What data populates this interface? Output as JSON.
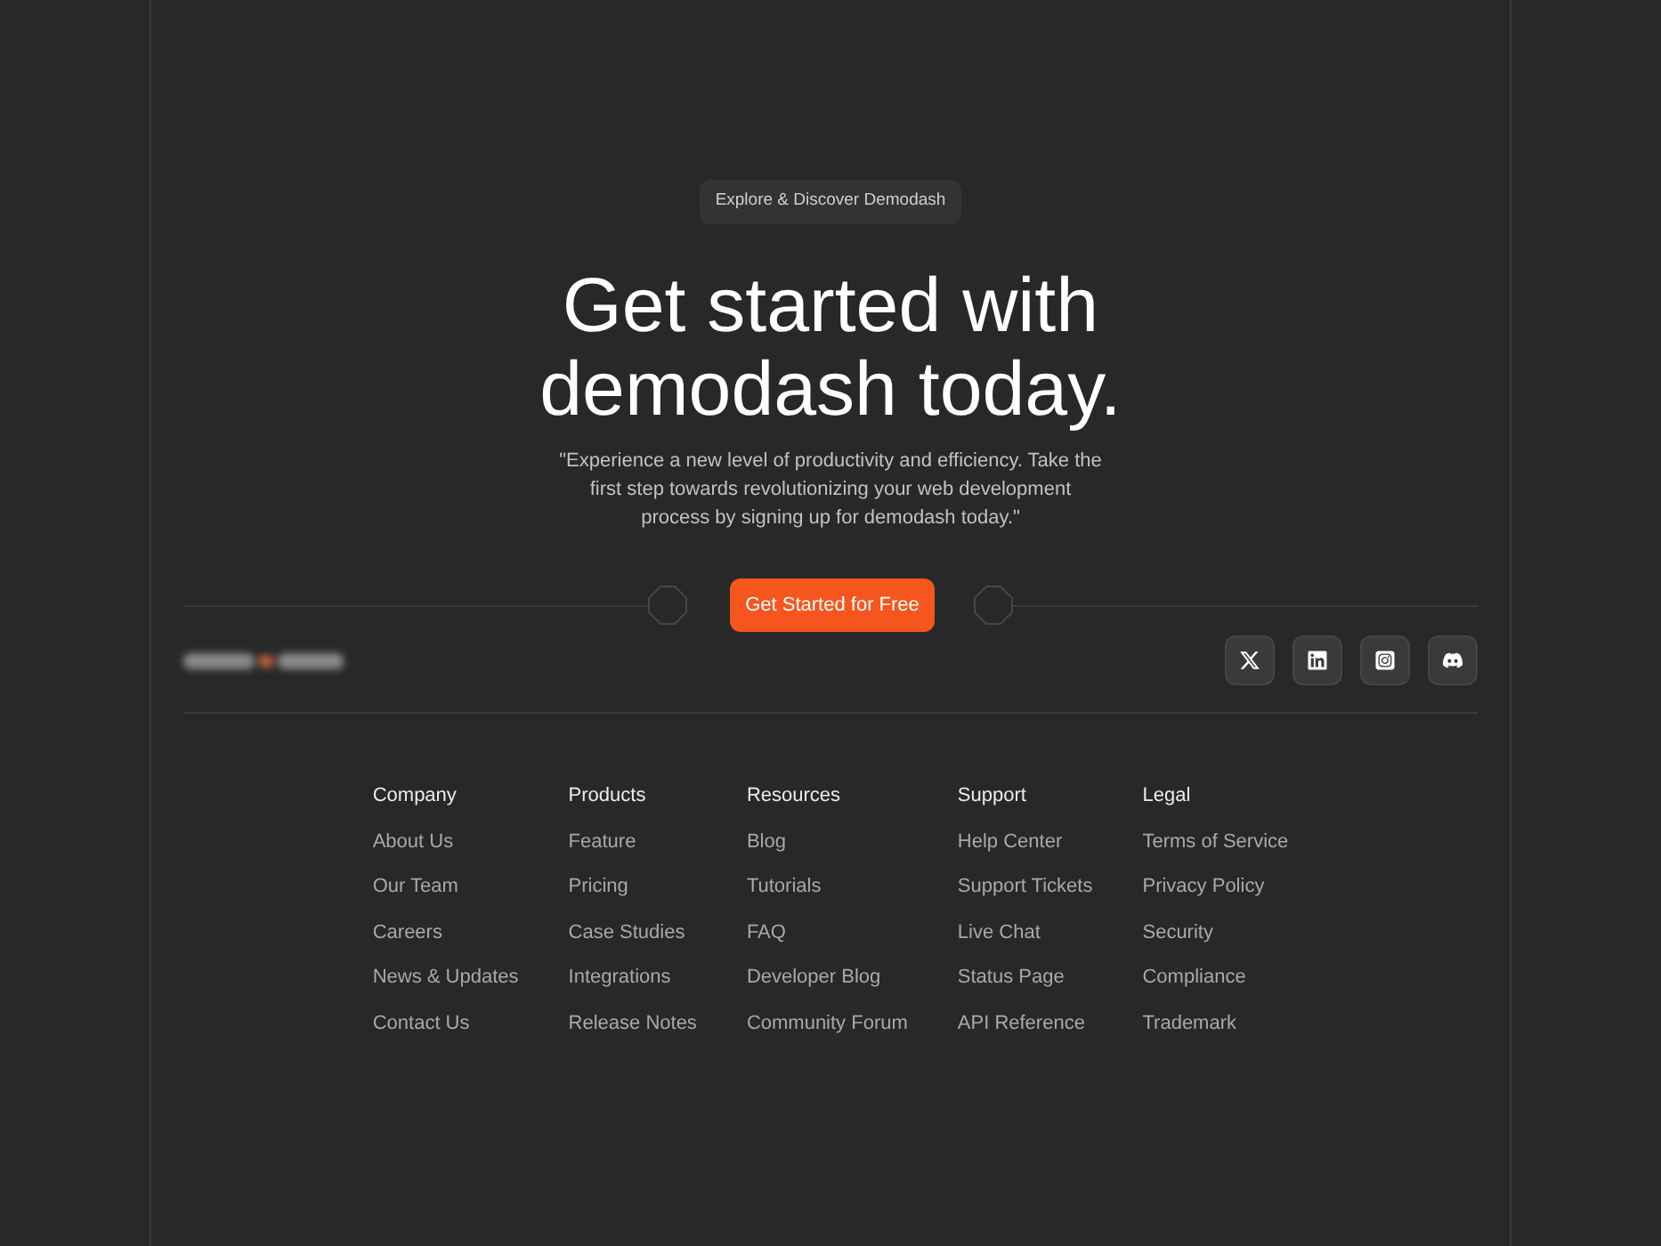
{
  "badge": "Explore & Discover Demodash",
  "hero": {
    "title": "Get started with demodash today.",
    "description": "\"Experience a new level of productivity and efficiency. Take the first step towards revolutionizing your web development process by signing up for demodash today.\"",
    "cta": "Get Started for Free"
  },
  "social_links": [
    {
      "kind": "x"
    },
    {
      "kind": "linkedin"
    },
    {
      "kind": "instagram"
    },
    {
      "kind": "discord"
    }
  ],
  "footer_columns": [
    {
      "heading": "Company",
      "links": [
        "About Us",
        "Our Team",
        "Careers",
        "News & Updates",
        "Contact Us"
      ]
    },
    {
      "heading": "Products",
      "links": [
        "Feature",
        "Pricing",
        "Case Studies",
        "Integrations",
        "Release Notes"
      ]
    },
    {
      "heading": "Resources",
      "links": [
        "Blog",
        "Tutorials",
        "FAQ",
        "Developer Blog",
        "Community Forum"
      ]
    },
    {
      "heading": "Support",
      "links": [
        "Help Center",
        "Support Tickets",
        "Live Chat",
        "Status Page",
        "API Reference"
      ]
    },
    {
      "heading": "Legal",
      "links": [
        "Terms of Service",
        "Privacy Policy",
        "Security",
        "Compliance",
        "Trademark"
      ]
    }
  ]
}
